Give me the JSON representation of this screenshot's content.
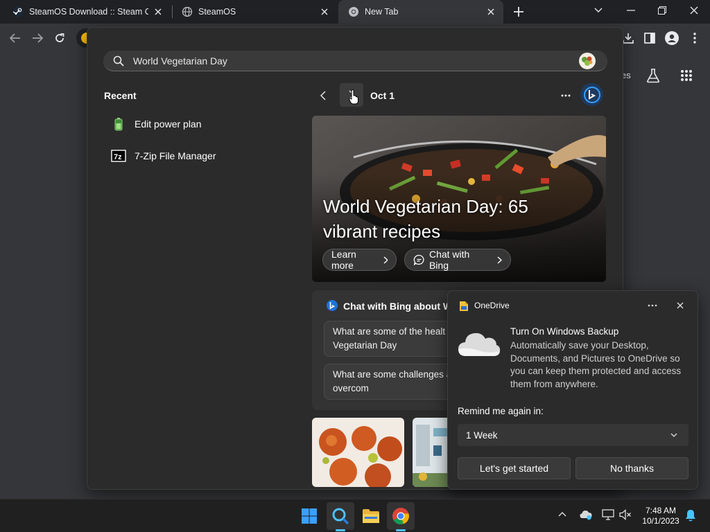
{
  "browser": {
    "tabs": [
      {
        "title": "SteamOS Download :: Steam Cor",
        "favicon": "steam-icon"
      },
      {
        "title": "SteamOS",
        "favicon": "globe-icon"
      },
      {
        "title": "New Tab",
        "favicon": "chrome-icon",
        "active": true
      }
    ],
    "page_partial_text": "es"
  },
  "search": {
    "query": "World Vegetarian Day",
    "recent_title": "Recent",
    "recent_items": [
      {
        "label": "Edit power plan",
        "icon": "battery-icon"
      },
      {
        "label": "7-Zip File Manager",
        "icon": "7zip-icon"
      }
    ],
    "date": "Oct 1",
    "hero": {
      "headline": "World Vegetarian Day: 65 vibrant recipes",
      "learn_more": "Learn more",
      "chat_with_bing": "Chat with Bing"
    },
    "chat_card": {
      "title": "Chat with Bing about W",
      "suggestions": [
        "What are some of the healt that World Vegetarian Day",
        "What are some challenges and how can they overcom"
      ]
    }
  },
  "onedrive": {
    "app_name": "OneDrive",
    "title": "Turn On Windows Backup",
    "body": "Automatically save your Desktop, Documents, and Pictures to OneDrive so you can keep them protected and access them from anywhere.",
    "remind_label": "Remind me again in:",
    "remind_value": "1 Week",
    "primary": "Let's get started",
    "secondary": "No thanks"
  },
  "taskbar": {
    "time": "7:48 AM",
    "date": "10/1/2023"
  },
  "colors": {
    "accent_blue": "#4cc2ff",
    "bing_blue": "#1e73d8"
  }
}
